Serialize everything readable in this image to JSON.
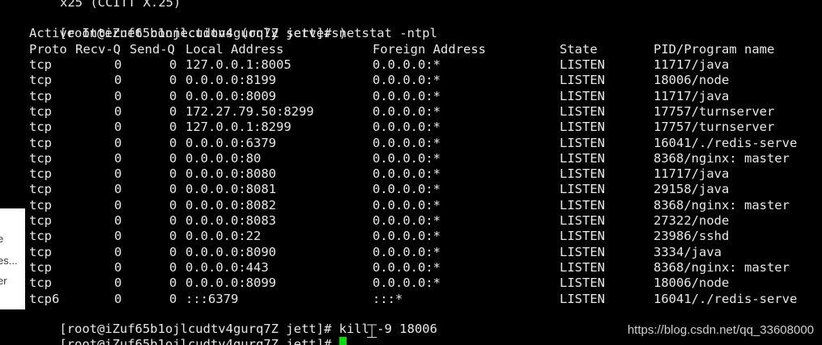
{
  "side_panel": {
    "fragments": [
      "e",
      "es...",
      "er"
    ]
  },
  "terminal": {
    "top_fragment": "x25 (CCITT X.25)",
    "prompt": "[root@iZuf65b1ojlcudtv4gurq7Z jett]#",
    "command1": "netstat -ntpl",
    "header_line": "Active Internet connections (only servers)",
    "columns": [
      "Proto",
      "Recv-Q",
      "Send-Q",
      "Local Address",
      "Foreign Address",
      "State",
      "PID/Program name"
    ],
    "rows": [
      {
        "proto": "tcp",
        "recvq": "0",
        "sendq": "0",
        "local": "127.0.0.1:8005",
        "foreign": "0.0.0.0:*",
        "state": "LISTEN",
        "pid": "11717/java"
      },
      {
        "proto": "tcp",
        "recvq": "0",
        "sendq": "0",
        "local": "0.0.0.0:8199",
        "foreign": "0.0.0.0:*",
        "state": "LISTEN",
        "pid": "18006/node"
      },
      {
        "proto": "tcp",
        "recvq": "0",
        "sendq": "0",
        "local": "0.0.0.0:8009",
        "foreign": "0.0.0.0:*",
        "state": "LISTEN",
        "pid": "11717/java"
      },
      {
        "proto": "tcp",
        "recvq": "0",
        "sendq": "0",
        "local": "172.27.79.50:8299",
        "foreign": "0.0.0.0:*",
        "state": "LISTEN",
        "pid": "17757/turnserver"
      },
      {
        "proto": "tcp",
        "recvq": "0",
        "sendq": "0",
        "local": "127.0.0.1:8299",
        "foreign": "0.0.0.0:*",
        "state": "LISTEN",
        "pid": "17757/turnserver"
      },
      {
        "proto": "tcp",
        "recvq": "0",
        "sendq": "0",
        "local": "0.0.0.0:6379",
        "foreign": "0.0.0.0:*",
        "state": "LISTEN",
        "pid": "16041/./redis-serve"
      },
      {
        "proto": "tcp",
        "recvq": "0",
        "sendq": "0",
        "local": "0.0.0.0:80",
        "foreign": "0.0.0.0:*",
        "state": "LISTEN",
        "pid": "8368/nginx: master"
      },
      {
        "proto": "tcp",
        "recvq": "0",
        "sendq": "0",
        "local": "0.0.0.0:8080",
        "foreign": "0.0.0.0:*",
        "state": "LISTEN",
        "pid": "11717/java"
      },
      {
        "proto": "tcp",
        "recvq": "0",
        "sendq": "0",
        "local": "0.0.0.0:8081",
        "foreign": "0.0.0.0:*",
        "state": "LISTEN",
        "pid": "29158/java"
      },
      {
        "proto": "tcp",
        "recvq": "0",
        "sendq": "0",
        "local": "0.0.0.0:8082",
        "foreign": "0.0.0.0:*",
        "state": "LISTEN",
        "pid": "8368/nginx: master"
      },
      {
        "proto": "tcp",
        "recvq": "0",
        "sendq": "0",
        "local": "0.0.0.0:8083",
        "foreign": "0.0.0.0:*",
        "state": "LISTEN",
        "pid": "27322/node"
      },
      {
        "proto": "tcp",
        "recvq": "0",
        "sendq": "0",
        "local": "0.0.0.0:22",
        "foreign": "0.0.0.0:*",
        "state": "LISTEN",
        "pid": "23986/sshd"
      },
      {
        "proto": "tcp",
        "recvq": "0",
        "sendq": "0",
        "local": "0.0.0.0:8090",
        "foreign": "0.0.0.0:*",
        "state": "LISTEN",
        "pid": "3334/java"
      },
      {
        "proto": "tcp",
        "recvq": "0",
        "sendq": "0",
        "local": "0.0.0.0:443",
        "foreign": "0.0.0.0:*",
        "state": "LISTEN",
        "pid": "8368/nginx: master"
      },
      {
        "proto": "tcp",
        "recvq": "0",
        "sendq": "0",
        "local": "0.0.0.0:8099",
        "foreign": "0.0.0.0:*",
        "state": "LISTEN",
        "pid": "18006/node"
      },
      {
        "proto": "tcp6",
        "recvq": "0",
        "sendq": "0",
        "local": ":::6379",
        "foreign": ":::*",
        "state": "LISTEN",
        "pid": "16041/./redis-serve"
      }
    ],
    "command2": "kill -9 18006",
    "cursor_color": "#00e000"
  },
  "watermark": "https://blog.csdn.net/qq_33608000"
}
